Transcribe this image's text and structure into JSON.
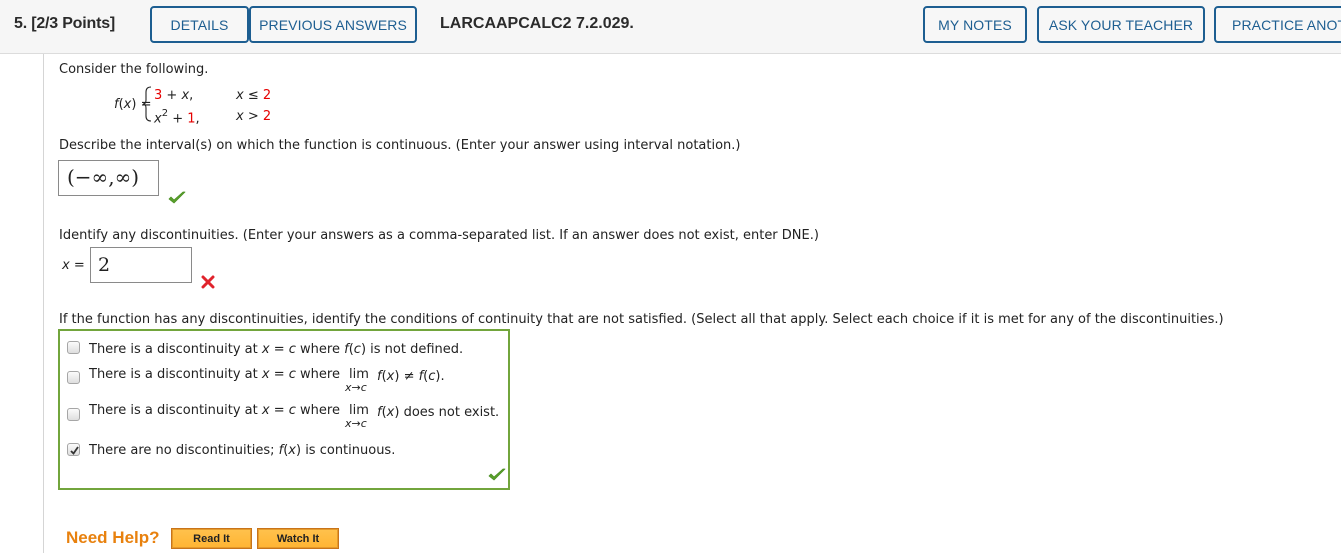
{
  "header": {
    "question_label": "5.  [2/3 Points]",
    "buttons": {
      "details": "DETAILS",
      "previous_answers": "PREVIOUS ANSWERS",
      "my_notes": "MY NOTES",
      "ask_teacher": "ASK YOUR TEACHER",
      "practice_another": "PRACTICE ANOTHER"
    },
    "reference": "LARCAAPCALC2 7.2.029."
  },
  "problem": {
    "intro": "Consider the following.",
    "function_label": "f(x) =",
    "pieces": [
      {
        "expr_a": "3",
        "expr_b": " + x,",
        "condition_var": "x ≤ ",
        "condition_val": "2"
      },
      {
        "expr_a": "x² + ",
        "expr_b": "1,",
        "condition_var": "x > ",
        "condition_val": "2"
      }
    ]
  },
  "part1": {
    "prompt": "Describe the interval(s) on which the function is continuous. (Enter your answer using interval notation.)",
    "answer": "(−∞,∞)",
    "status": "correct"
  },
  "part2": {
    "prompt": "Identify any discontinuities. (Enter your answers as a comma-separated list. If an answer does not exist, enter DNE.)",
    "label": "x =",
    "answer": "2",
    "status": "incorrect"
  },
  "part3": {
    "prompt": "If the function has any discontinuities, identify the conditions of continuity that are not satisfied. (Select all that apply. Select each choice if it is met for any of the discontinuities.)",
    "choices": [
      {
        "text_a": "There is a discontinuity at ",
        "var": "x",
        "text_b": " = ",
        "c": "c",
        "text_c": " where ",
        "text_d": "f(c)",
        "text_e": " is not defined.",
        "checked": false
      },
      {
        "text_a": "There is a discontinuity at ",
        "var": "x",
        "text_b": " = ",
        "c": "c",
        "text_c": " where ",
        "lim": "lim",
        "lim_sub": "x→c",
        "text_d": "f(x)",
        "text_e": " ≠ f(c).",
        "checked": false
      },
      {
        "text_a": "There is a discontinuity at ",
        "var": "x",
        "text_b": " = ",
        "c": "c",
        "text_c": " where ",
        "lim": "lim",
        "lim_sub": "x→c",
        "text_d": "f(x)",
        "text_e": " does not exist.",
        "checked": false
      },
      {
        "text_a": "There are no discontinuities; ",
        "text_d": "f(x)",
        "text_e": " is continuous.",
        "checked": true
      }
    ],
    "status": "correct"
  },
  "help": {
    "label": "Need Help?",
    "read_it": "Read It",
    "watch_it": "Watch It"
  },
  "colors": {
    "header_button": "#1d5e91",
    "correct": "#5aa02c",
    "incorrect": "#e0232c",
    "highlight_red": "#e60000",
    "help_orange": "#e8810e",
    "choice_border": "#72a53c"
  }
}
